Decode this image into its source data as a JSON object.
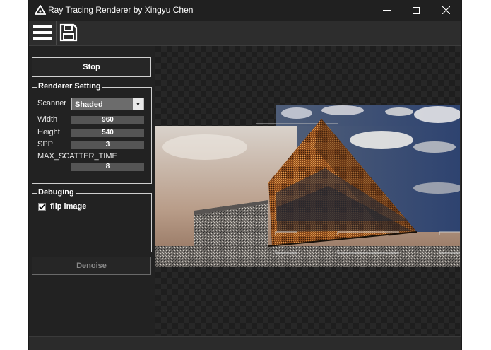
{
  "window": {
    "title": "Ray Tracing Renderer by Xingyu Chen",
    "controls": {
      "minimize": "—",
      "maximize": "☐",
      "close": "✕"
    }
  },
  "toolbar": {
    "menu_icon": "hamburger-menu-icon",
    "save_icon": "save-floppy-icon"
  },
  "panel": {
    "stop_label": "Stop",
    "renderer_group": "Renderer Setting",
    "scanner_label": "Scanner",
    "scanner_value": "Shaded",
    "width_label": "Width",
    "width_value": "960",
    "height_label": "Height",
    "height_value": "540",
    "spp_label": "SPP",
    "spp_value": "3",
    "scatter_label": "MAX_SCATTER_TIME",
    "scatter_value": "8",
    "debug_group": "Debuging",
    "flip_label": "flip image",
    "flip_checked": true,
    "denoise_label": "Denoise"
  },
  "colors": {
    "panel_bg": "#222222",
    "window_bg": "#2b2b2b",
    "titlebar_bg": "#202020"
  }
}
